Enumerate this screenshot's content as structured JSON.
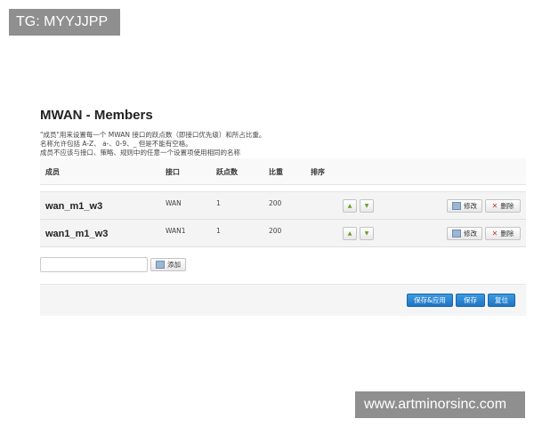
{
  "watermarks": {
    "top_left": "TG: MYYJJPP",
    "bottom_right": "www.artminorsinc.com"
  },
  "page": {
    "title": "MWAN - Members",
    "description": [
      "\"成员\"用来设置每一个 MWAN 接口的跃点数（即接口优先级）和所占比重。",
      "名称允许包括 A-Z、 a-、0-9、_ 但是不能有空格。",
      "成员不应该与接口、策略、规则中的任意一个设置项使用相同的名称"
    ]
  },
  "table": {
    "headers": {
      "member": "成员",
      "interface": "接口",
      "metric": "跃点数",
      "weight": "比重",
      "sort": "排序"
    },
    "rows": [
      {
        "name": "wan_m1_w3",
        "interface": "WAN",
        "metric": "1",
        "weight": "200"
      },
      {
        "name": "wan1_m1_w3",
        "interface": "WAN1",
        "metric": "1",
        "weight": "200"
      }
    ],
    "edit_label": "修改",
    "delete_label": "删除"
  },
  "add": {
    "input_value": "",
    "button_label": "添加"
  },
  "footer": {
    "save_apply": "保存&应用",
    "save": "保存",
    "reset": "复位"
  },
  "colors": {
    "primary_button": "#1f74c4",
    "arrow": "#6a9a2a",
    "delete": "#c0392b",
    "row_bg": "#f4f4f4"
  },
  "icons": {
    "up": "arrow-up-icon",
    "down": "arrow-down-icon",
    "edit": "edit-icon",
    "delete": "delete-icon",
    "add": "add-icon"
  }
}
